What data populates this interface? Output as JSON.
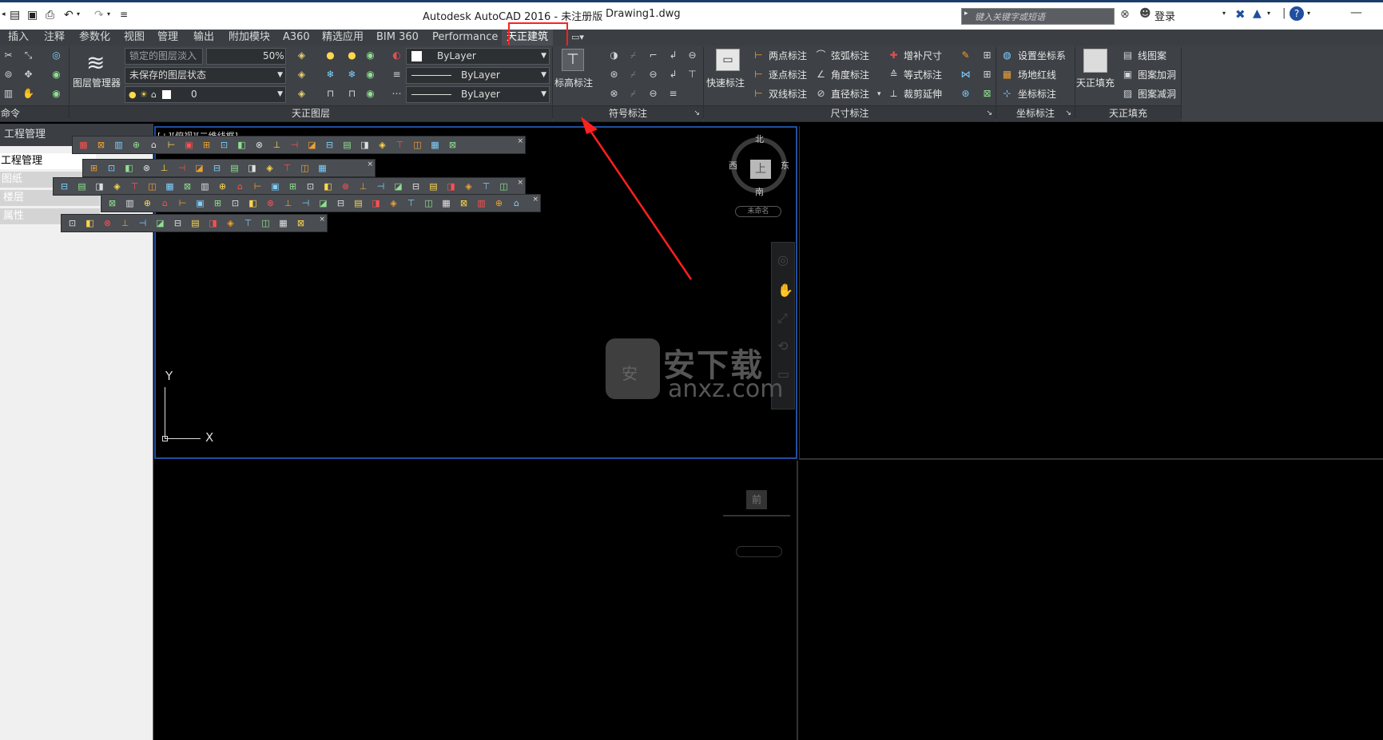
{
  "app": {
    "title": "Autodesk AutoCAD 2016 - 未注册版",
    "filename": "Drawing1.dwg",
    "search_placeholder": "键入关键字或短语",
    "login": "登录"
  },
  "tabs": [
    {
      "label": "插入"
    },
    {
      "label": "注释"
    },
    {
      "label": "参数化"
    },
    {
      "label": "视图"
    },
    {
      "label": "管理"
    },
    {
      "label": "输出"
    },
    {
      "label": "附加模块"
    },
    {
      "label": "A360"
    },
    {
      "label": "精选应用"
    },
    {
      "label": "BIM 360"
    },
    {
      "label": "Performance"
    },
    {
      "label": "天正建筑"
    }
  ],
  "ribbon": {
    "panels": {
      "command": "命令",
      "layers": "天正图层",
      "symbols": "符号标注",
      "dimensions": "尺寸标注",
      "coordinates": "坐标标注",
      "fill": "天正填充"
    },
    "layer_manager": "图层管理器",
    "lock_fade": "锁定的图层淡入",
    "lock_fade_value": "50%",
    "layer_state": "未保存的图层状态",
    "current_layer": "0",
    "bylayer_color": "ByLayer",
    "bylayer_linetype": "ByLayer",
    "bylayer_lineweight": "ByLayer",
    "elevation": "标高标注",
    "quick_dim": "快速标注",
    "dims": [
      "两点标注",
      "逐点标注",
      "双线标注",
      "弦弧标注",
      "角度标注",
      "直径标注",
      "增补尺寸",
      "等式标注",
      "裁剪延伸"
    ],
    "coords": [
      "设置坐标系",
      "场地红线",
      "坐标标注"
    ],
    "fill_btn": "天正填充",
    "fill": [
      "线图案",
      "图案加洞",
      "图案减洞"
    ]
  },
  "sidebar": {
    "header": "工程管理",
    "title": "工程管理",
    "items": [
      "图纸",
      "楼层",
      "属性"
    ]
  },
  "viewport": {
    "label": "[+][俯视][二维线框]",
    "compass": {
      "n": "北",
      "s": "南",
      "e": "东",
      "w": "西",
      "top": "上"
    },
    "wcs": "未命名",
    "ucs_y": "Y",
    "ucs_x": "X"
  },
  "watermark": {
    "cn": "安下载",
    "url": "anxz.com",
    "shield": "安"
  },
  "colors": {
    "highlight": "#ff2020",
    "accent_border": "#1f4f9e"
  }
}
